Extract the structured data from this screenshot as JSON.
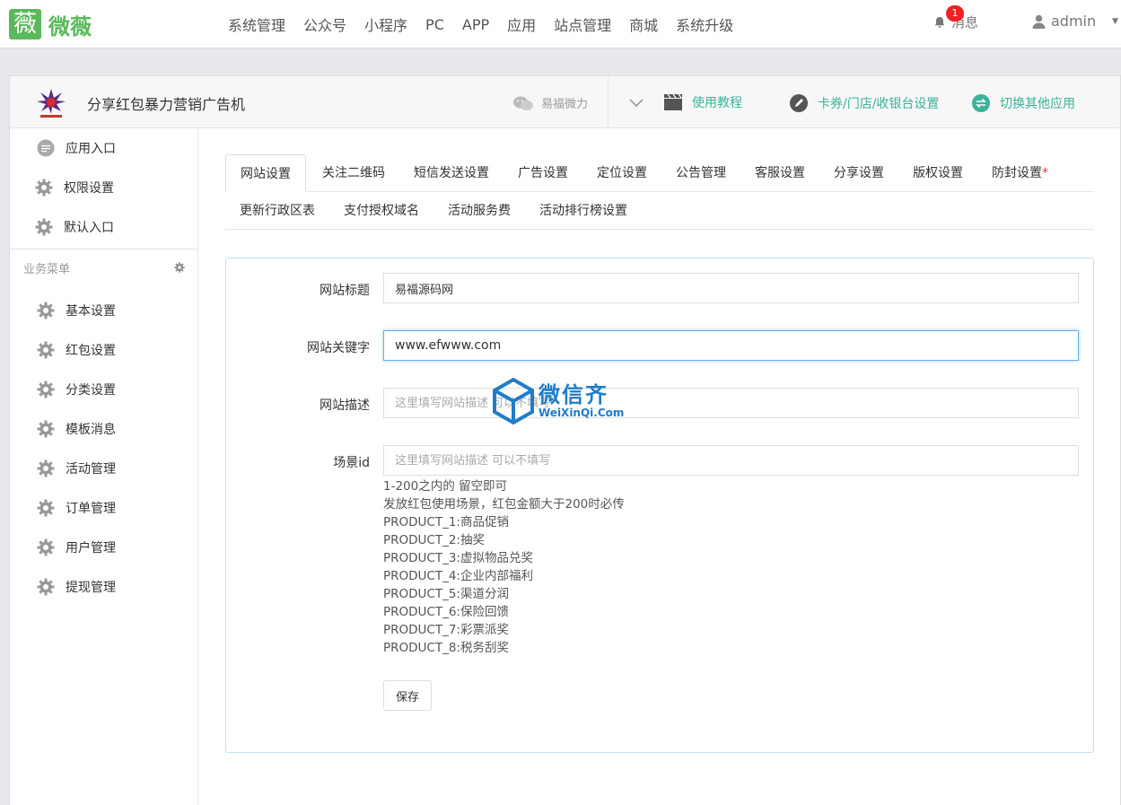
{
  "topbar": {
    "logo_glyph": "薇",
    "logo_text": "微薇",
    "nav": [
      "系统管理",
      "公众号",
      "小程序",
      "PC",
      "APP",
      "应用",
      "站点管理",
      "商城",
      "系统升级"
    ],
    "notice_label": "消息",
    "notice_count": "1",
    "user_name": "admin"
  },
  "app_header": {
    "title": "分享红包暴力营销广告机",
    "wechat_account": "易福微力",
    "links": {
      "tutorial": "使用教程",
      "coupon": "卡券/门店/收银台设置",
      "switch": "切换其他应用"
    }
  },
  "sidebar": {
    "top_items": [
      "应用入口",
      "权限设置",
      "默认入口"
    ],
    "group_title": "业务菜单",
    "items": [
      "基本设置",
      "红包设置",
      "分类设置",
      "模板消息",
      "活动管理",
      "订单管理",
      "用户管理",
      "提现管理"
    ]
  },
  "tabs": {
    "row1": [
      "网站设置",
      "关注二维码",
      "短信发送设置",
      "广告设置",
      "定位设置",
      "公告管理",
      "客服设置",
      "分享设置",
      "版权设置",
      "防封设置"
    ],
    "row2": [
      "更新行政区表",
      "支付授权域名",
      "活动服务费",
      "活动排行榜设置"
    ],
    "required_mark": "*"
  },
  "form": {
    "title_label": "网站标题",
    "title_value": "易福源码网",
    "keywords_label": "网站关键字",
    "keywords_value": "www.efwww.com",
    "desc_label": "网站描述",
    "desc_placeholder": "这里填写网站描述 可以不填写",
    "scene_label": "场景id",
    "scene_placeholder": "这里填写网站描述 可以不填写",
    "help_lines": [
      "1-200之内的 留空即可",
      "发放红包使用场景，红包金额大于200时必传",
      "PRODUCT_1:商品促销",
      "PRODUCT_2:抽奖",
      "PRODUCT_3:虚拟物品兑奖",
      "PRODUCT_4:企业内部福利",
      "PRODUCT_5:渠道分润",
      "PRODUCT_6:保险回馈",
      "PRODUCT_7:彩票派奖",
      "PRODUCT_8:税务刮奖"
    ],
    "save_label": "保存"
  },
  "watermark": {
    "big": "微信齐",
    "small": "WeiXinQi.Com"
  },
  "colors": {
    "brand_green": "#5cb85c",
    "link_teal": "#3bb39a",
    "focus_blue": "#66afe9",
    "badge_red": "#ee2222"
  }
}
